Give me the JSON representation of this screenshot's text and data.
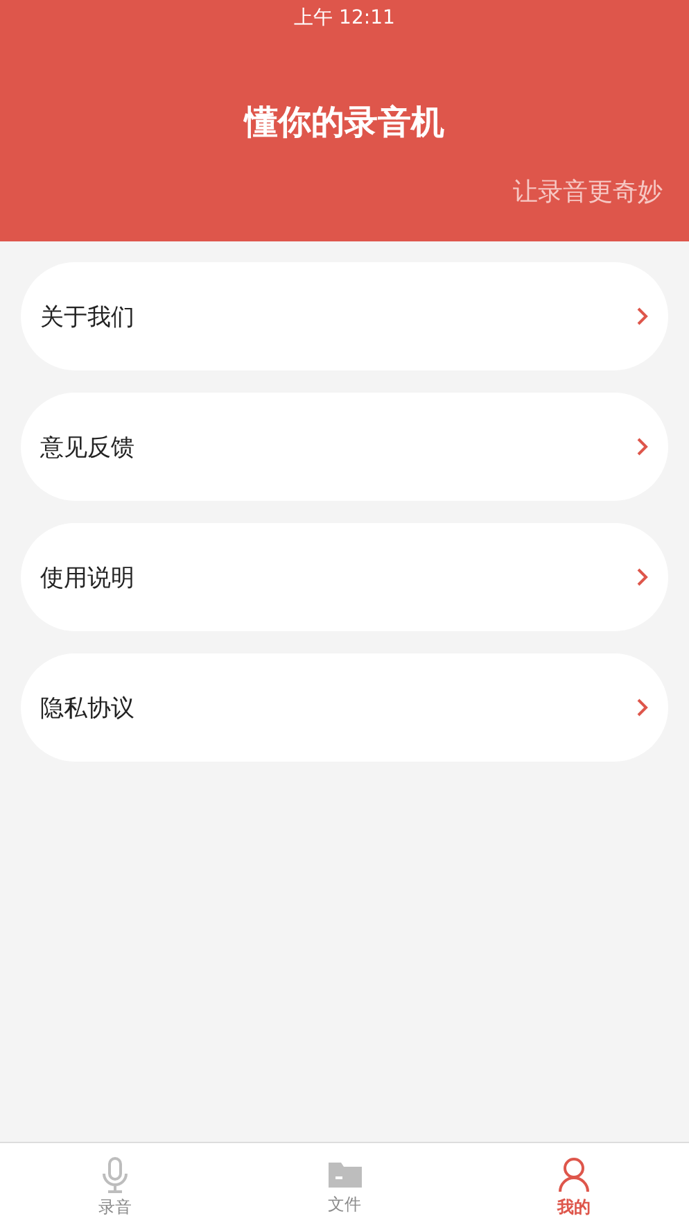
{
  "status_bar": {
    "time": "上午 12:11"
  },
  "header": {
    "title": "懂你的录音机",
    "slogan": "让录音更奇妙"
  },
  "menu": [
    {
      "label": "关于我们"
    },
    {
      "label": "意见反馈"
    },
    {
      "label": "使用说明"
    },
    {
      "label": "隐私协议"
    }
  ],
  "tab_bar": [
    {
      "kind": "mic",
      "label": "录音",
      "selected": false
    },
    {
      "kind": "folder",
      "label": "文件",
      "selected": false
    },
    {
      "kind": "person",
      "label": "我的",
      "selected": true
    }
  ]
}
